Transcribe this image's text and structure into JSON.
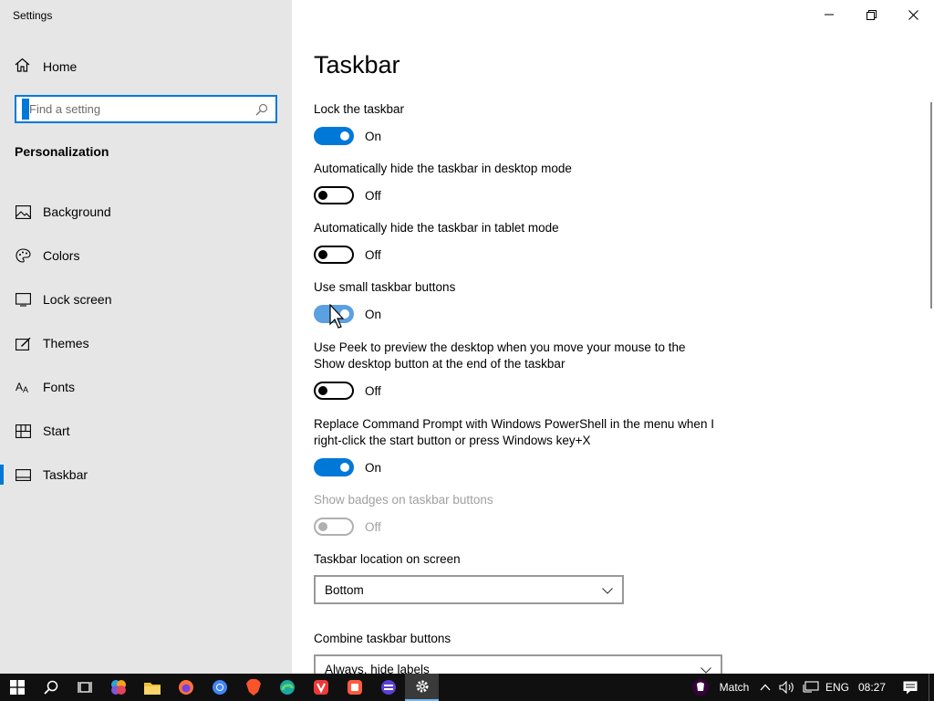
{
  "window": {
    "title": "Settings",
    "minimize_glyph": "—",
    "maximize_glyph": "❐",
    "close_glyph": "✕"
  },
  "sidebar": {
    "home_label": "Home",
    "search_placeholder": "Find a setting",
    "section_title": "Personalization",
    "items": [
      {
        "label": "Background",
        "icon": "picture-icon"
      },
      {
        "label": "Colors",
        "icon": "palette-icon"
      },
      {
        "label": "Lock screen",
        "icon": "lock-screen-icon"
      },
      {
        "label": "Themes",
        "icon": "themes-icon"
      },
      {
        "label": "Fonts",
        "icon": "fonts-icon"
      },
      {
        "label": "Start",
        "icon": "start-icon"
      },
      {
        "label": "Taskbar",
        "icon": "taskbar-icon",
        "active": true
      }
    ]
  },
  "main": {
    "title": "Taskbar",
    "settings": [
      {
        "label": "Lock the taskbar",
        "state": "On"
      },
      {
        "label": "Automatically hide the taskbar in desktop mode",
        "state": "Off"
      },
      {
        "label": "Automatically hide the taskbar in tablet mode",
        "state": "Off"
      },
      {
        "label": "Use small taskbar buttons",
        "state": "On"
      },
      {
        "label": "Use Peek to preview the desktop when you move your mouse to the Show desktop button at the end of the taskbar",
        "state": "Off"
      },
      {
        "label": "Replace Command Prompt with Windows PowerShell in the menu when I right-click the start button or press Windows key+X",
        "state": "On"
      },
      {
        "label": "Show badges on taskbar buttons",
        "state": "Off",
        "disabled": true
      }
    ],
    "location": {
      "label": "Taskbar location on screen",
      "value": "Bottom"
    },
    "combine": {
      "label": "Combine taskbar buttons",
      "value": "Always, hide labels"
    }
  },
  "taskbar": {
    "apps": [
      "start-icon",
      "search-icon",
      "task-view-icon",
      "copilot-icon",
      "file-explorer-icon",
      "firefox-icon",
      "chrome-icon",
      "brave-icon",
      "edge-icon",
      "vivaldi-icon",
      "app-orange-icon",
      "app-purple-icon",
      "settings-icon"
    ],
    "tray_label": "Match",
    "language": "ENG",
    "time": "08:27"
  },
  "colors": {
    "accent": "#0078d7",
    "sidebar_bg": "#e6e6e6",
    "taskbar_bg": "#101010"
  }
}
